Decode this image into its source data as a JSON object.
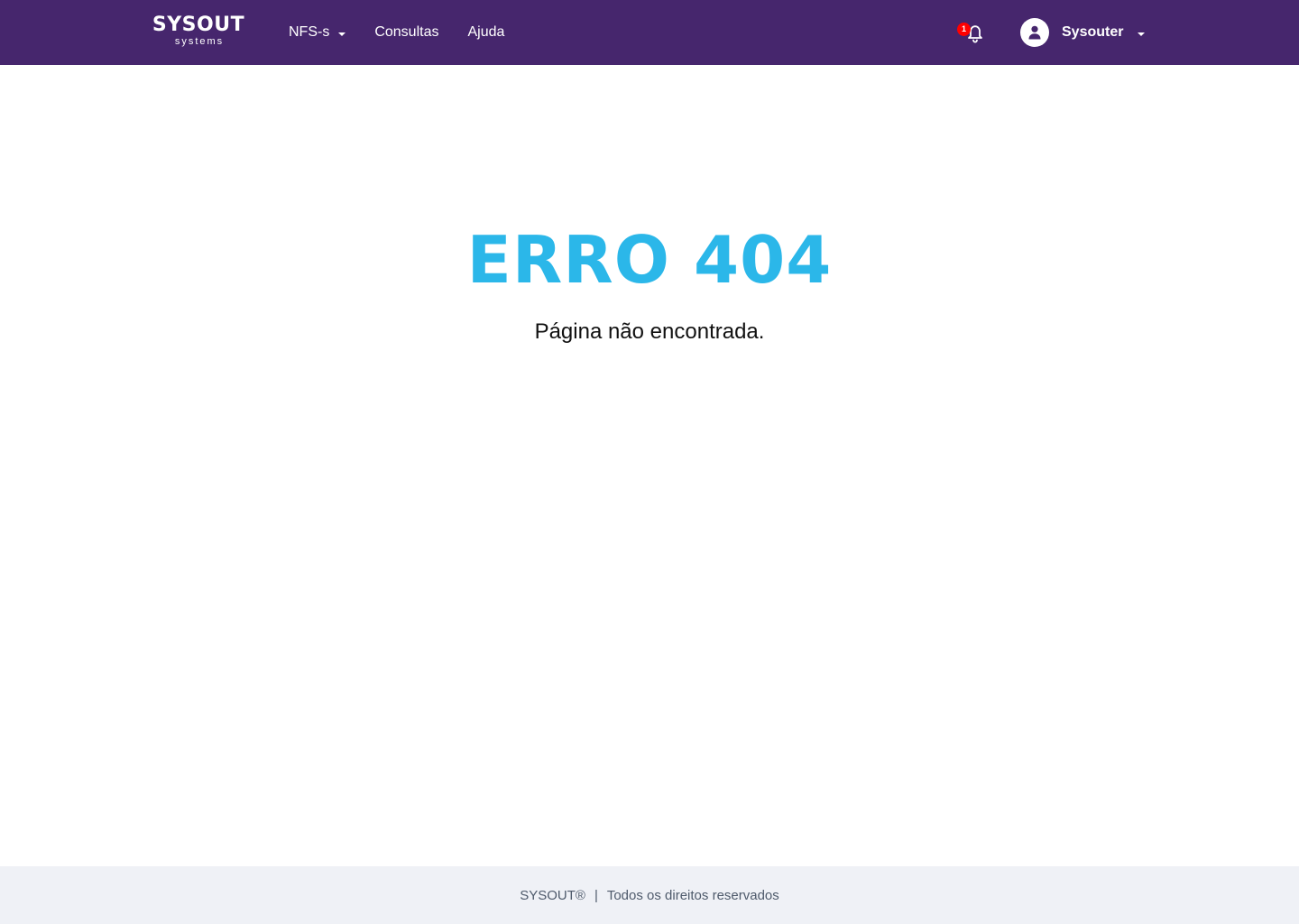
{
  "header": {
    "logo_main": "SYSOUT",
    "logo_sub": "systems",
    "nav": {
      "nfs_label": "NFS-s",
      "consultas_label": "Consultas",
      "ajuda_label": "Ajuda"
    },
    "notifications": {
      "count": "1",
      "icon": "bell-icon"
    },
    "user": {
      "name": "Sysouter",
      "icon": "user-avatar-icon"
    }
  },
  "main": {
    "error_title": "ERRO 404",
    "error_message": "Página não encontrada."
  },
  "footer": {
    "brand": "SYSOUT®",
    "separator": "|",
    "rights": "Todos os direitos reservados"
  },
  "colors": {
    "header_bg": "#46266d",
    "accent": "#2bb7e9",
    "badge": "#ff0000",
    "footer_bg": "#eff1f6"
  }
}
